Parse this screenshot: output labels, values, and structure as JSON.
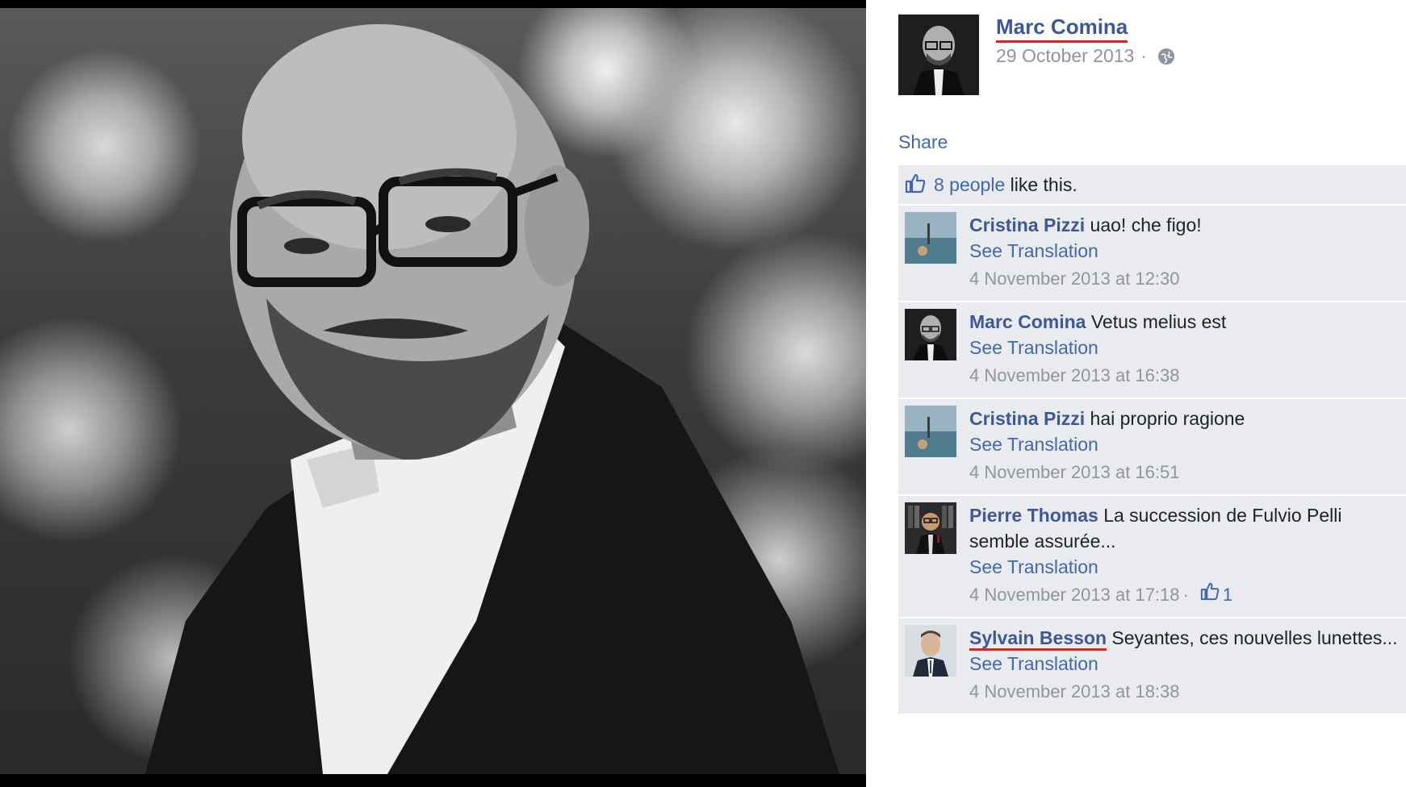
{
  "post": {
    "author": "Marc Comina",
    "date": "29 October 2013",
    "separator": "·",
    "privacy_icon": "globe-icon"
  },
  "actions": {
    "share": "Share"
  },
  "likes": {
    "count_link": "8 people",
    "suffix": "like this.",
    "icon": "thumbs-up-icon"
  },
  "comments": [
    {
      "author": "Cristina Pizzi",
      "text": "uao! che figo!",
      "translation": "See Translation",
      "time": "4 November 2013 at 12:30",
      "avatar": "sea-photo-avatar"
    },
    {
      "author": "Marc Comina",
      "text": "Vetus melius est",
      "translation": "See Translation",
      "time": "4 November 2013 at 16:38",
      "avatar": "portrait-avatar"
    },
    {
      "author": "Cristina Pizzi",
      "text": "hai proprio ragione",
      "translation": "See Translation",
      "time": "4 November 2013 at 16:51",
      "avatar": "sea-photo-avatar"
    },
    {
      "author": "Pierre Thomas",
      "text": "La succession de Fulvio Pelli semble assurée...",
      "translation": "See Translation",
      "time": "4 November 2013 at 17:18",
      "likes_separator": "·",
      "likes": "1",
      "avatar": "wine-photo-avatar"
    },
    {
      "author": "Sylvain Besson",
      "text": "Seyantes, ces nouvelles lunettes...",
      "translation": "See Translation",
      "time": "4 November 2013 at 18:38",
      "avatar": "suit-portrait-avatar"
    }
  ],
  "colors": {
    "link": "#3b5998",
    "muted": "#90949c",
    "panel": "#e9ebee",
    "underline": "#e02424"
  }
}
